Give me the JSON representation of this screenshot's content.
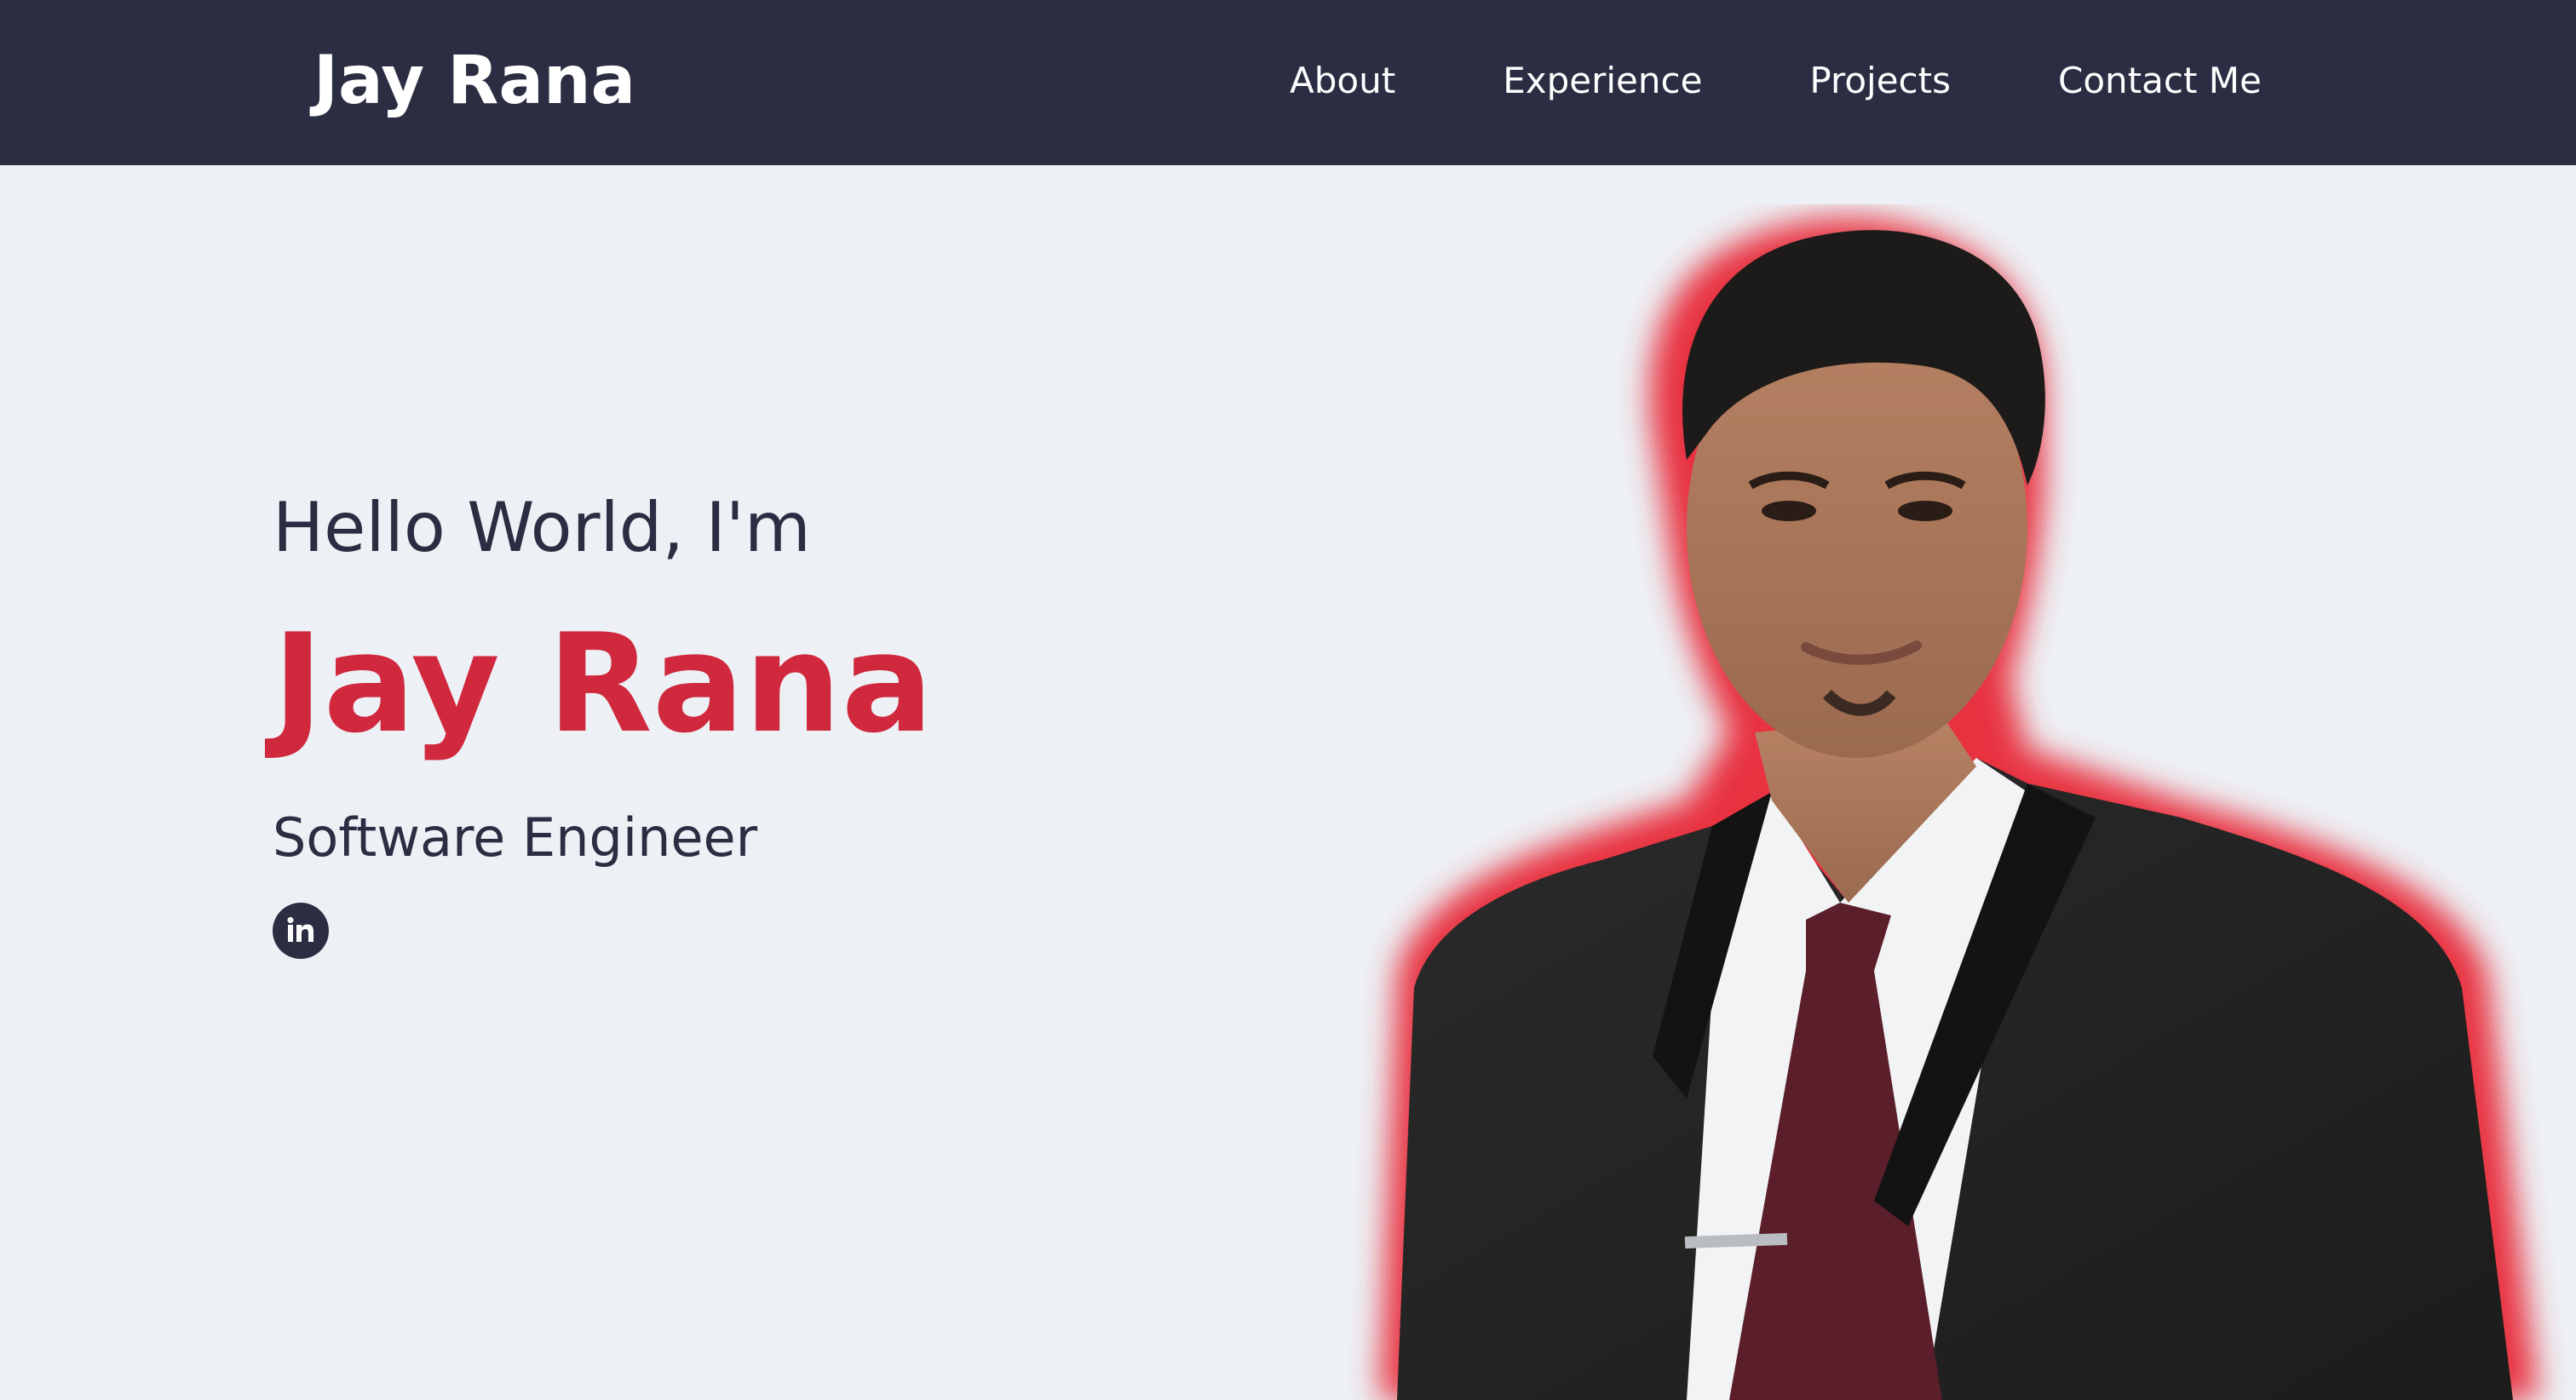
{
  "header": {
    "brand": "Jay Rana",
    "nav": [
      {
        "label": "About"
      },
      {
        "label": "Experience"
      },
      {
        "label": "Projects"
      },
      {
        "label": "Contact Me"
      }
    ]
  },
  "hero": {
    "greeting": "Hello World, I'm",
    "name": "Jay Rana",
    "role": "Software Engineer",
    "social": [
      {
        "icon": "linkedin-icon"
      }
    ],
    "photo_alt": "portrait-photo"
  },
  "colors": {
    "nav_bg": "#2b2d42",
    "page_bg": "#edf1f5",
    "accent": "#d0283d",
    "text_dark": "#2b2d42"
  }
}
